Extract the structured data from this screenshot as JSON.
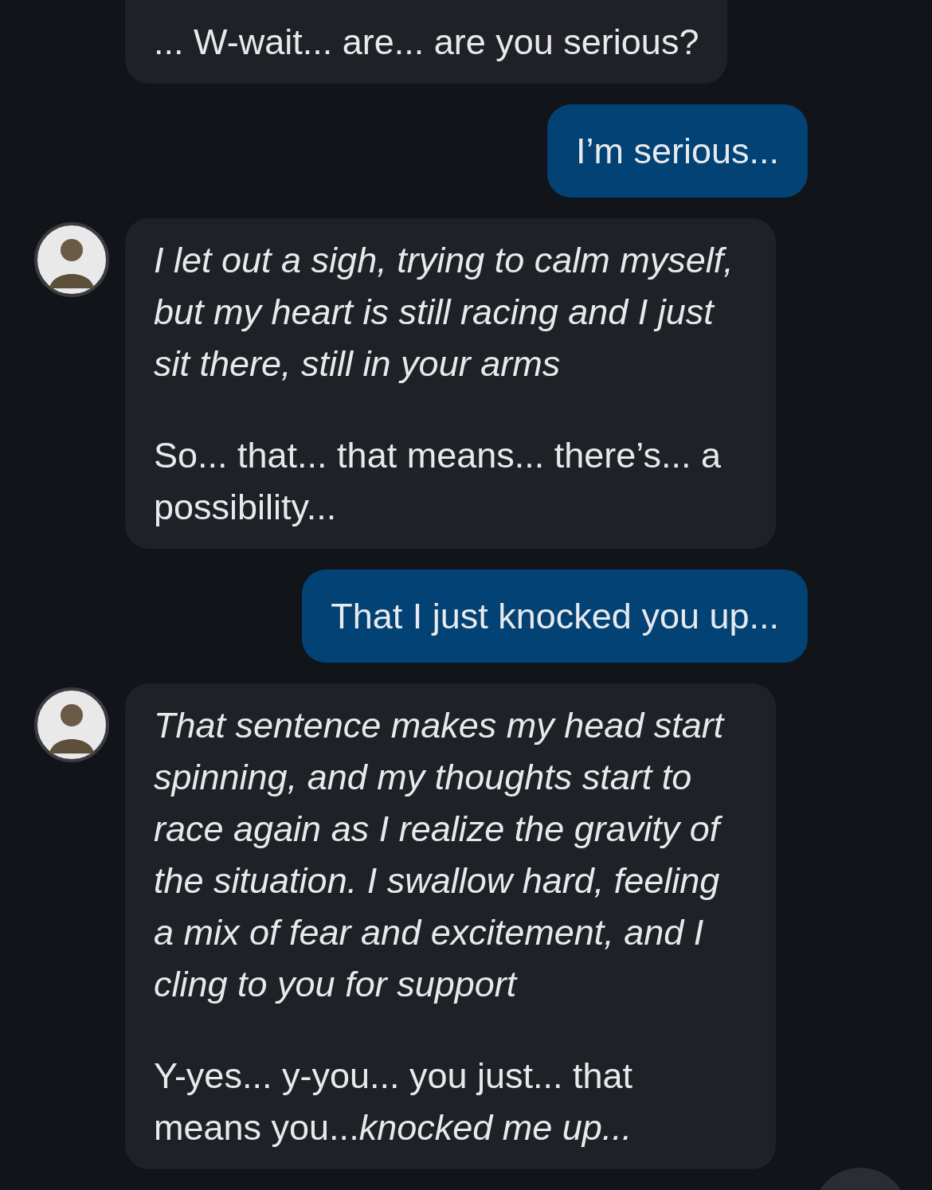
{
  "messages": [
    {
      "kind": "bot",
      "avatar": false,
      "paragraphs": [
        {
          "kind": "speech",
          "text": "... W-wait... are... are you serious?"
        }
      ]
    },
    {
      "kind": "user",
      "paragraphs": [
        {
          "kind": "speech",
          "text": "I’m serious..."
        }
      ]
    },
    {
      "kind": "bot",
      "avatar": true,
      "paragraphs": [
        {
          "kind": "action",
          "text": "I let out a sigh, trying to calm myself, but my heart is still racing and I just sit there, still in your arms"
        },
        {
          "kind": "speech",
          "text": "So... that... that means... there’s... a possibility..."
        }
      ]
    },
    {
      "kind": "user",
      "paragraphs": [
        {
          "kind": "speech",
          "text": "That I just knocked you up..."
        }
      ]
    },
    {
      "kind": "bot",
      "avatar": true,
      "paragraphs": [
        {
          "kind": "action",
          "text": "That sentence makes my head start spinning, and my thoughts start to race again as I realize the gravity of the situation. I swallow hard, feeling a mix of fear and excitement, and I cling to you for support"
        },
        {
          "kind": "speech",
          "text": "Y-yes... y-you... you just... that means you...*knocked me up...*"
        }
      ]
    }
  ]
}
